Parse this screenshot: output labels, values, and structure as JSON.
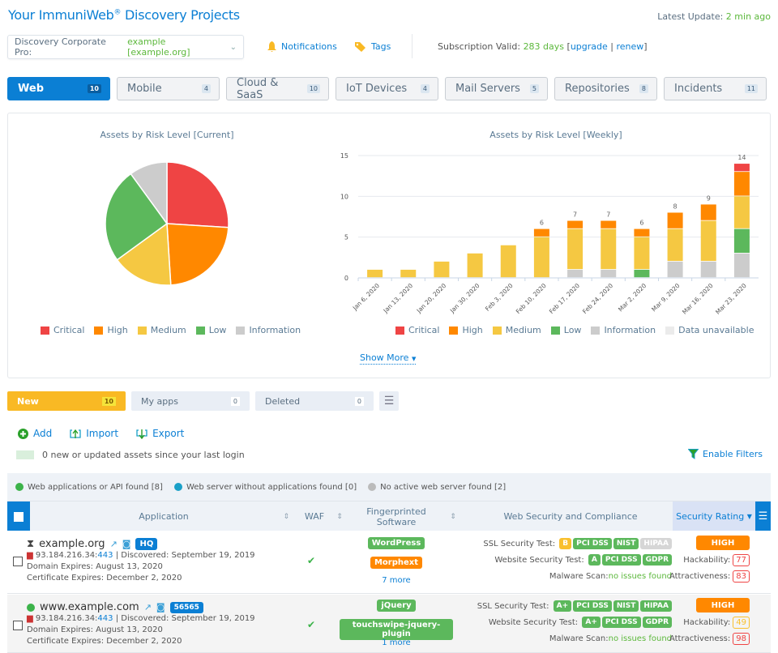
{
  "header": {
    "title": "Your ImmuniWeb",
    "title_reg": "®",
    "title_suffix": " Discovery Projects",
    "latest_update_label": "Latest Update: ",
    "latest_update_value": "2 min ago",
    "project_select": {
      "prefix": "Discovery Corporate Pro: ",
      "value": "example [example.org]"
    },
    "notifications_label": "Notifications",
    "tags_label": "Tags",
    "subscription_label": "Subscription Valid: ",
    "subscription_days": "283 days",
    "upgrade_label": "upgrade",
    "renew_label": "renew"
  },
  "tabs": [
    {
      "label": "Web",
      "count": "10",
      "active": true
    },
    {
      "label": "Mobile",
      "count": "4"
    },
    {
      "label": "Cloud & SaaS",
      "count": "10"
    },
    {
      "label": "IoT Devices",
      "count": "4"
    },
    {
      "label": "Mail Servers",
      "count": "5"
    },
    {
      "label": "Repositories",
      "count": "8"
    },
    {
      "label": "Incidents",
      "count": "11"
    }
  ],
  "colors": {
    "critical": "#ef4444",
    "high": "#ff8800",
    "medium": "#f5c842",
    "low": "#5cb85c",
    "information": "#cccccc",
    "unavailable": "#ebebeb",
    "accent": "#0b7fd4"
  },
  "chart_data": [
    {
      "type": "pie",
      "title": "Assets by Risk Level [Current]",
      "categories": [
        "Critical",
        "High",
        "Medium",
        "Low",
        "Information"
      ],
      "values": [
        26,
        23,
        16,
        25,
        10
      ],
      "legend": [
        "Critical",
        "High",
        "Medium",
        "Low",
        "Information"
      ],
      "legend_position": "bottom"
    },
    {
      "type": "bar",
      "stacked": true,
      "title": "Assets by Risk Level [Weekly]",
      "categories": [
        "Jan 6, 2020",
        "Jan 13, 2020",
        "Jan 20, 2020",
        "Jan 30, 2020",
        "Feb 3, 2020",
        "Feb 10, 2020",
        "Feb 17, 2020",
        "Feb 24, 2020",
        "Mar 2, 2020",
        "Mar 9, 2020",
        "Mar 16, 2020",
        "Mar 23, 2020"
      ],
      "series": [
        {
          "name": "Information",
          "values": [
            0,
            0,
            0,
            0,
            0,
            0,
            1,
            1,
            0,
            2,
            2,
            3
          ]
        },
        {
          "name": "Low",
          "values": [
            0,
            0,
            0,
            0,
            0,
            0,
            0,
            0,
            1,
            0,
            0,
            3
          ]
        },
        {
          "name": "Medium",
          "values": [
            1,
            1,
            2,
            3,
            4,
            5,
            5,
            5,
            4,
            4,
            5,
            4
          ]
        },
        {
          "name": "High",
          "values": [
            0,
            0,
            0,
            0,
            0,
            1,
            1,
            1,
            1,
            2,
            2,
            3
          ]
        },
        {
          "name": "Critical",
          "values": [
            0,
            0,
            0,
            0,
            0,
            0,
            0,
            0,
            0,
            0,
            0,
            1
          ]
        }
      ],
      "totals_labels": [
        "",
        "",
        "",
        "",
        "",
        "6",
        "7",
        "7",
        "6",
        "8",
        "9",
        "14"
      ],
      "yticks": [
        0,
        5,
        10,
        15
      ],
      "ylim": [
        0,
        15
      ],
      "grid": true,
      "legend": [
        "Critical",
        "High",
        "Medium",
        "Low",
        "Information",
        "Data unavailable"
      ],
      "legend_position": "bottom"
    }
  ],
  "show_more_label": "Show More",
  "subtabs": [
    {
      "label": "New",
      "count": "10",
      "active": true
    },
    {
      "label": "My apps",
      "count": "0"
    },
    {
      "label": "Deleted",
      "count": "0"
    }
  ],
  "actions": {
    "add": "Add",
    "import": "Import",
    "export": "Export"
  },
  "new_assets_text": "0 new or updated assets since your last login",
  "enable_filters_label": "Enable Filters",
  "status_legend": [
    {
      "label": "Web applications or API found [8]",
      "color": "#3cb34a"
    },
    {
      "label": "Web server without applications found [0]",
      "color": "#1aa0c8"
    },
    {
      "label": "No active web server found [2]",
      "color": "#bbbbbb"
    }
  ],
  "table": {
    "headers": {
      "application": "Application",
      "waf": "WAF",
      "software": "Fingerprinted Software",
      "compliance": "Web Security and Compliance",
      "rating": "Security Rating"
    },
    "rows": [
      {
        "name": "example.org",
        "tag": "HQ",
        "ip": "93.184.216.34:",
        "port": "443",
        "discovered": " | Discovered: September 19, 2019",
        "domain_expires": "Domain Expires: August 13, 2020",
        "cert_expires": "Certificate Expires: December 2, 2020",
        "waf": "✔",
        "software": [
          {
            "label": "WordPress",
            "color": "#5cb85c"
          },
          {
            "label": "Morphext",
            "color": "#ff8800"
          }
        ],
        "more": "7 more",
        "ssl_label": "SSL Security Test:",
        "ssl": [
          {
            "label": "B",
            "color": "#f9c02e"
          },
          {
            "label": "PCI DSS",
            "color": "#5cb85c"
          },
          {
            "label": "NIST",
            "color": "#5cb85c"
          },
          {
            "label": "HIPAA",
            "color": "#d6d6d6"
          }
        ],
        "web_label": "Website Security Test:",
        "web": [
          {
            "label": "A",
            "color": "#5cb85c"
          },
          {
            "label": "PCI DSS",
            "color": "#5cb85c"
          },
          {
            "label": "GDPR",
            "color": "#5cb85c"
          }
        ],
        "malware_label": "Malware Scan: ",
        "malware_value": "no issues found",
        "rating": "HIGH",
        "hackability_label": "Hackability:",
        "hackability": "77",
        "hackability_color": "#ef4444",
        "attractiveness_label": "Attractiveness:",
        "attractiveness": "83",
        "attractiveness_color": "#ef4444"
      },
      {
        "name": "www.example.com",
        "tag": "56565",
        "ip": "93.184.216.34:",
        "port": "443",
        "discovered": " | Discovered: September 19, 2019",
        "domain_expires": "Domain Expires: August 13, 2020",
        "cert_expires": "Certificate Expires: December 2, 2020",
        "waf": "✔",
        "software": [
          {
            "label": "jQuery",
            "color": "#5cb85c"
          },
          {
            "label": "touchswipe-jquery-plugin",
            "color": "#5cb85c"
          }
        ],
        "more": "1 more",
        "ssl_label": "SSL Security Test:",
        "ssl": [
          {
            "label": "A+",
            "color": "#5cb85c"
          },
          {
            "label": "PCI DSS",
            "color": "#5cb85c"
          },
          {
            "label": "NIST",
            "color": "#5cb85c"
          },
          {
            "label": "HIPAA",
            "color": "#5cb85c"
          }
        ],
        "web_label": "Website Security Test:",
        "web": [
          {
            "label": "A+",
            "color": "#5cb85c"
          },
          {
            "label": "PCI DSS",
            "color": "#5cb85c"
          },
          {
            "label": "GDPR",
            "color": "#5cb85c"
          }
        ],
        "malware_label": "Malware Scan: ",
        "malware_value": "no issues found",
        "rating": "HIGH",
        "hackability_label": "Hackability:",
        "hackability": "49",
        "hackability_color": "#f9c02e",
        "attractiveness_label": "Attractiveness:",
        "attractiveness": "98",
        "attractiveness_color": "#ef4444"
      }
    ]
  }
}
